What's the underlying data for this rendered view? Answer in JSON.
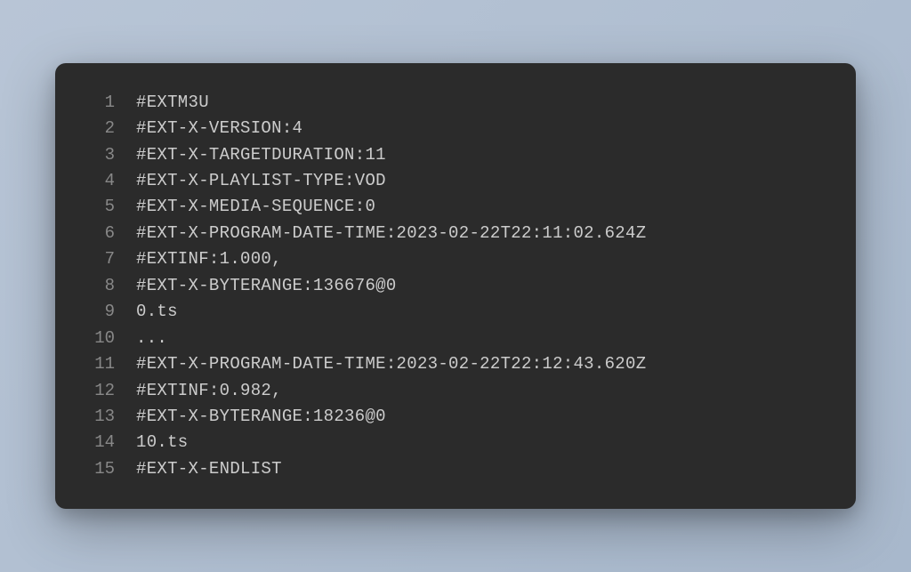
{
  "code": {
    "lines": [
      {
        "num": "1",
        "text": "#EXTM3U"
      },
      {
        "num": "2",
        "text": "#EXT-X-VERSION:4"
      },
      {
        "num": "3",
        "text": "#EXT-X-TARGETDURATION:11"
      },
      {
        "num": "4",
        "text": "#EXT-X-PLAYLIST-TYPE:VOD"
      },
      {
        "num": "5",
        "text": "#EXT-X-MEDIA-SEQUENCE:0"
      },
      {
        "num": "6",
        "text": "#EXT-X-PROGRAM-DATE-TIME:2023-02-22T22:11:02.624Z"
      },
      {
        "num": "7",
        "text": "#EXTINF:1.000,"
      },
      {
        "num": "8",
        "text": "#EXT-X-BYTERANGE:136676@0"
      },
      {
        "num": "9",
        "text": "0.ts"
      },
      {
        "num": "10",
        "text": "..."
      },
      {
        "num": "11",
        "text": "#EXT-X-PROGRAM-DATE-TIME:2023-02-22T22:12:43.620Z"
      },
      {
        "num": "12",
        "text": "#EXTINF:0.982,"
      },
      {
        "num": "13",
        "text": "#EXT-X-BYTERANGE:18236@0"
      },
      {
        "num": "14",
        "text": "10.ts"
      },
      {
        "num": "15",
        "text": "#EXT-X-ENDLIST"
      }
    ]
  }
}
